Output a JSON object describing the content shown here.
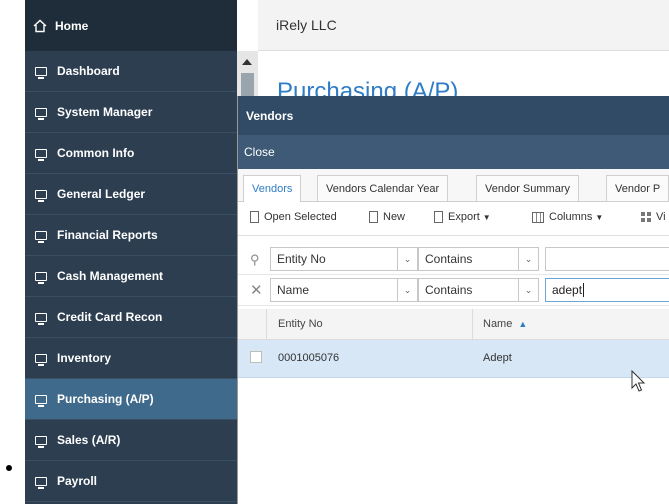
{
  "sidebar": {
    "home_label": "Home",
    "items": [
      {
        "label": "Dashboard"
      },
      {
        "label": "System Manager"
      },
      {
        "label": "Common Info"
      },
      {
        "label": "General Ledger"
      },
      {
        "label": "Financial Reports"
      },
      {
        "label": "Cash Management"
      },
      {
        "label": "Credit Card Recon"
      },
      {
        "label": "Inventory"
      },
      {
        "label": "Purchasing (A/P)",
        "active": true
      },
      {
        "label": "Sales (A/R)"
      },
      {
        "label": "Payroll"
      }
    ]
  },
  "header": {
    "company": "iRely LLC",
    "page_title": "Purchasing (A/P)"
  },
  "dialog": {
    "title": "Vendors",
    "toolbar_close": "Close",
    "tabs": [
      {
        "label": "Vendors",
        "active": true
      },
      {
        "label": "Vendors Calendar Year"
      },
      {
        "label": "Vendor Summary"
      },
      {
        "label": "Vendor P"
      }
    ],
    "actions": {
      "open_selected": "Open Selected",
      "new": "New",
      "export": "Export",
      "columns": "Columns",
      "view": "Vi"
    },
    "filters": [
      {
        "field": "Entity No",
        "operator": "Contains",
        "value": ""
      },
      {
        "field": "Name",
        "operator": "Contains",
        "value": "adept"
      }
    ],
    "grid": {
      "columns": [
        "Entity No",
        "Name"
      ],
      "sort_indicator": "▲",
      "rows": [
        {
          "entity_no": "0001005076",
          "name": "Adept",
          "selected": true
        }
      ]
    }
  },
  "colors": {
    "sidebar_bg": "#2c3e50",
    "sidebar_active": "#3f6a8c",
    "dialog_header": "#314b66",
    "accent": "#2e7cc6",
    "row_selected": "#d7e7f5"
  }
}
